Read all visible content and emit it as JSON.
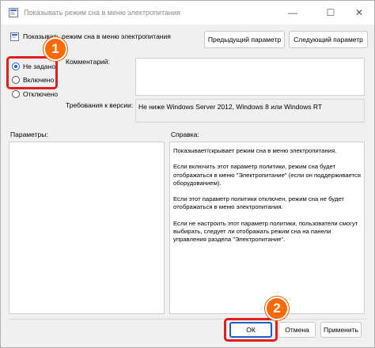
{
  "window": {
    "title": "Показывать режим сна в меню электропитания",
    "controls": {
      "minimize": "—",
      "maximize": "☐",
      "close": "✕"
    }
  },
  "policy": {
    "name": "Показывать режим сна в меню электропитания",
    "prev_label": "Предыдущий параметр",
    "next_label": "Следующий параметр"
  },
  "state": {
    "options": [
      {
        "label": "Не задано",
        "checked": true
      },
      {
        "label": "Включено",
        "checked": false
      },
      {
        "label": "Отключено",
        "checked": false
      }
    ]
  },
  "comment": {
    "label": "Комментарий:",
    "value": ""
  },
  "supported": {
    "label": "Требования к версии:",
    "value": "Не ниже Windows Server 2012, Windows 8 или Windows RT"
  },
  "options_panel": {
    "label": "Параметры:"
  },
  "help_panel": {
    "label": "Справка:",
    "paragraphs": [
      "Показывает/скрывает режим сна в меню электропитания.",
      "Если включить этот параметр политики, режим сна будет отображаться в меню \"Электропитание\" (если он поддерживается оборудованием).",
      "Если этот параметр политики отключен, режим сна не будет отображаться в меню электропитания.",
      "Если не настроить этот параметр политики, пользователи смогут выбирать, следует ли отображать режим сна на панели управления раздела \"Электропитание\"."
    ]
  },
  "footer": {
    "ok_label": "ОК",
    "cancel_label": "Отмена",
    "apply_label": "Применить"
  },
  "annotations": {
    "badge1": "1",
    "badge2": "2",
    "highlight_color": "#e01e1e",
    "badge_color": "#ff6a00"
  },
  "colors": {
    "accent": "#1a62c8"
  }
}
